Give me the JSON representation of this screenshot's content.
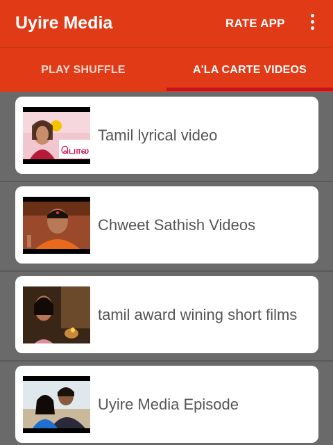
{
  "appbar": {
    "title": "Uyire Media",
    "rate_label": "RATE APP",
    "more_icon": "more-vert-icon",
    "color": "#e03a17"
  },
  "tabs": [
    {
      "label": "PLAY SHUFFLE",
      "selected": false
    },
    {
      "label": "A'LA CARTE VIDEOS",
      "selected": true
    }
  ],
  "list": {
    "items": [
      {
        "title": "Tamil lyrical video"
      },
      {
        "title": "Chweet Sathish Videos"
      },
      {
        "title": "tamil award wining short films"
      },
      {
        "title": "Uyire Media Episode"
      }
    ]
  }
}
